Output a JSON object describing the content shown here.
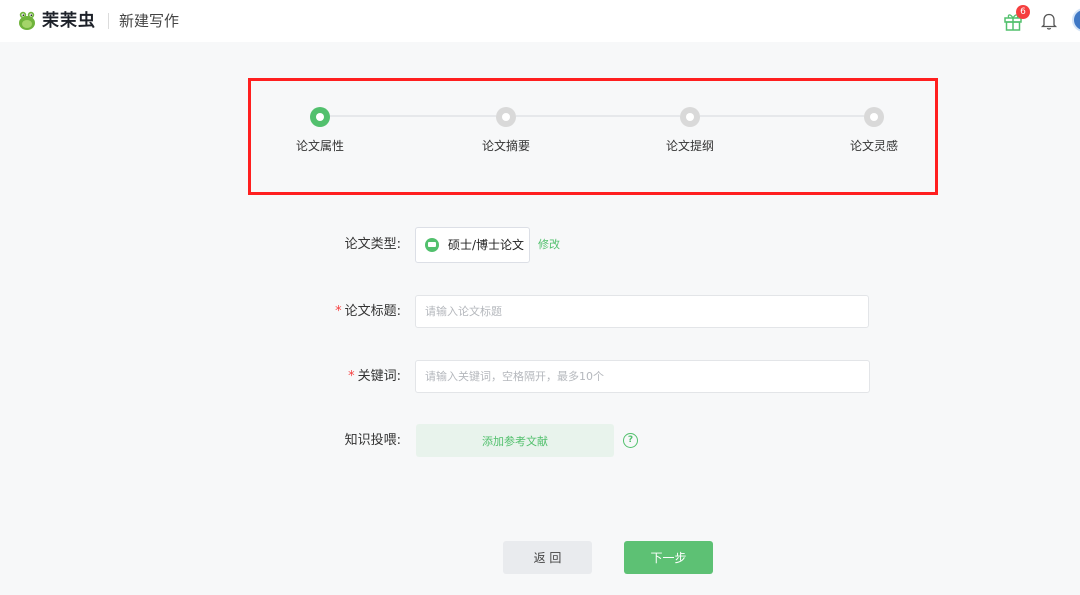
{
  "header": {
    "brand": "茉茉虫",
    "page_title": "新建写作",
    "gift_badge": "6",
    "icons": [
      "bug-logo-icon",
      "gift-icon",
      "bell-icon",
      "avatar"
    ]
  },
  "steps": [
    {
      "label": "论文属性",
      "active": true
    },
    {
      "label": "论文摘要",
      "active": false
    },
    {
      "label": "论文提纲",
      "active": false
    },
    {
      "label": "论文灵感",
      "active": false
    }
  ],
  "form": {
    "type": {
      "label": "论文类型:",
      "value": "硕士/博士论文",
      "modify": "修改"
    },
    "title": {
      "required_mark": "*",
      "label": "论文标题:",
      "placeholder": "请输入论文标题",
      "value": ""
    },
    "keywords": {
      "required_mark": "*",
      "label": "关键词:",
      "placeholder": "请输入关键词，空格隔开，最多10个",
      "value": ""
    },
    "knowledge": {
      "label": "知识投喂:",
      "button": "添加参考文献",
      "help": "?"
    }
  },
  "actions": {
    "back": "返 回",
    "next": "下一步"
  },
  "colors": {
    "accent": "#52c06d",
    "highlight_border": "#ff1f1f",
    "badge": "#f53f3f"
  }
}
